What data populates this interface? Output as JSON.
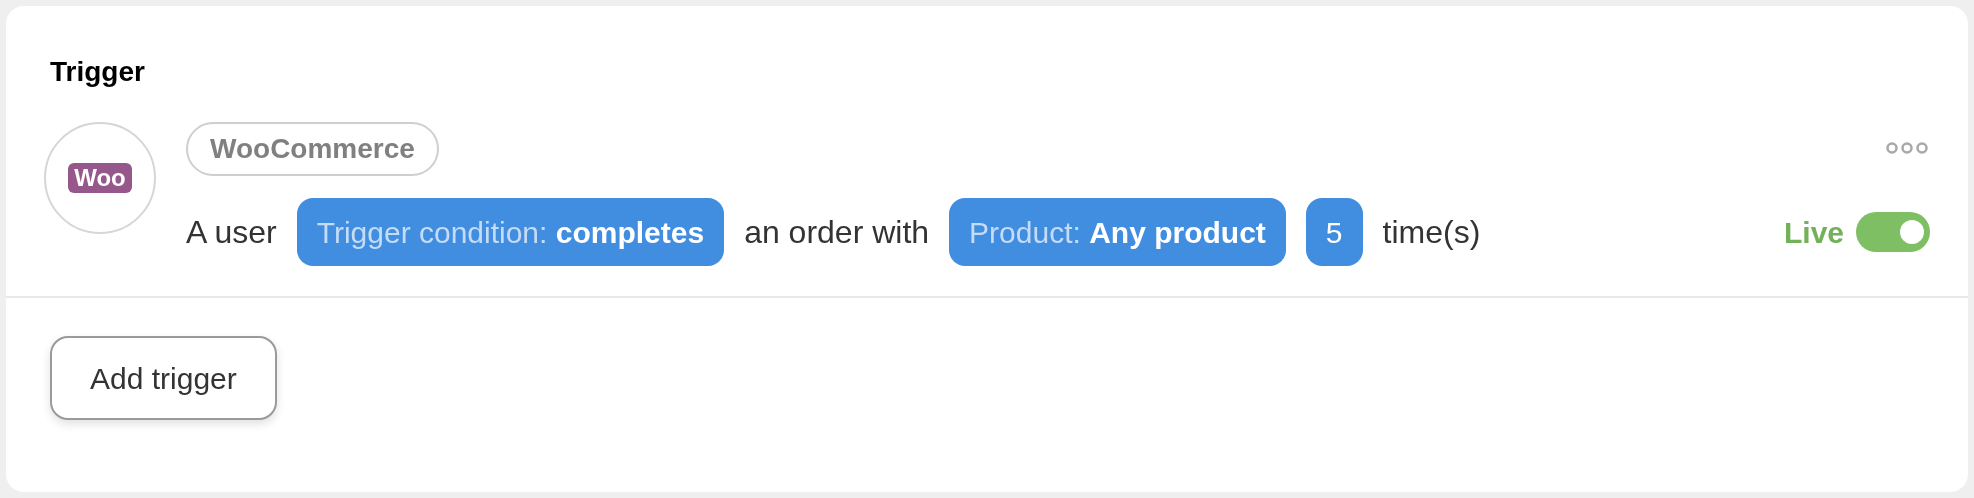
{
  "section": {
    "title": "Trigger"
  },
  "trigger": {
    "integration": "WooCommerce",
    "logo": "Woo",
    "sentence": [
      {
        "kind": "text",
        "text": "A user"
      },
      {
        "kind": "pill",
        "label": "Trigger condition:",
        "value": "completes"
      },
      {
        "kind": "text",
        "text": "an order with"
      },
      {
        "kind": "pill",
        "label": "Product:",
        "value": "Any product"
      },
      {
        "kind": "number",
        "value": "5"
      },
      {
        "kind": "text",
        "text": "time(s)"
      }
    ],
    "status": {
      "label": "Live",
      "on": true
    }
  },
  "buttons": [
    "Add trigger"
  ]
}
